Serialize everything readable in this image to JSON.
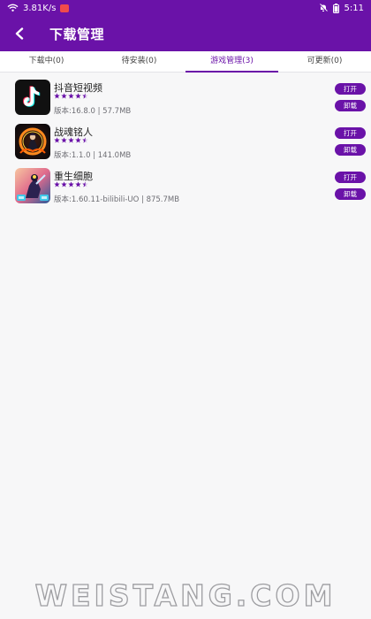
{
  "statusbar": {
    "speed": "3.81K/s",
    "time": "5:11"
  },
  "header": {
    "title": "下载管理"
  },
  "tabs": [
    {
      "label": "下载中(0)",
      "active": false
    },
    {
      "label": "待安装(0)",
      "active": false
    },
    {
      "label": "游戏管理(3)",
      "active": true
    },
    {
      "label": "可更新(0)",
      "active": false
    }
  ],
  "apps": [
    {
      "name": "抖音短视频",
      "rating": 4.5,
      "meta": "版本:16.8.0 | 57.7MB",
      "open_label": "打开",
      "uninstall_label": "卸载"
    },
    {
      "name": "战魂铭人",
      "rating": 4.5,
      "meta": "版本:1.1.0 | 141.0MB",
      "open_label": "打开",
      "uninstall_label": "卸载"
    },
    {
      "name": "重生细胞",
      "rating": 4.5,
      "meta": "版本:1.60.11-bilibili-UO | 875.7MB",
      "open_label": "打开",
      "uninstall_label": "卸载"
    }
  ],
  "watermark": {
    "text": "WEISTANG.COM"
  },
  "colors": {
    "accent": "#6a12a8",
    "background": "#f7f7f8"
  }
}
